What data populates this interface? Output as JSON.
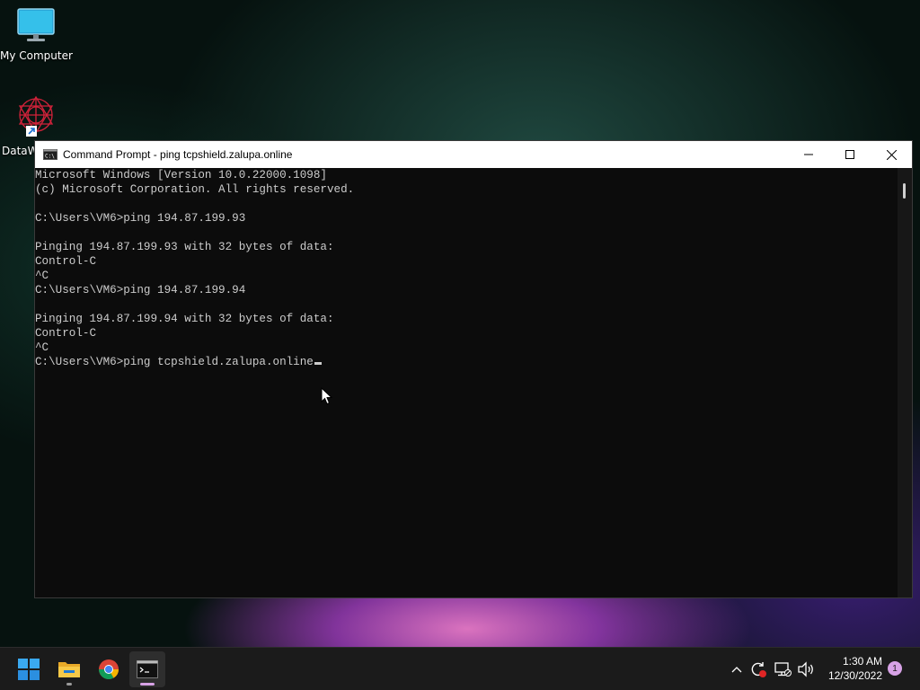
{
  "desktop": {
    "icons": [
      {
        "label": "My Computer",
        "icon": "monitor-icon"
      },
      {
        "label": "DataW",
        "icon": "datawatch-icon"
      }
    ]
  },
  "window": {
    "title": "Command Prompt - ping  tcpshield.zalupa.online",
    "app_icon": "cmd-icon",
    "controls": [
      "minimize-icon",
      "maximize-icon",
      "close-icon"
    ]
  },
  "console": {
    "lines": [
      "Microsoft Windows [Version 10.0.22000.1098]",
      "(c) Microsoft Corporation. All rights reserved.",
      "",
      "C:\\Users\\VM6>ping 194.87.199.93",
      "",
      "Pinging 194.87.199.93 with 32 bytes of data:",
      "Control-C",
      "^C",
      "C:\\Users\\VM6>ping 194.87.199.94",
      "",
      "Pinging 194.87.199.94 with 32 bytes of data:",
      "Control-C",
      "^C",
      "C:\\Users\\VM6>ping tcpshield.zalupa.online"
    ]
  },
  "taskbar": {
    "apps": [
      "start-icon",
      "file-explorer-icon",
      "chrome-icon",
      "terminal-icon"
    ],
    "active_app": "terminal-icon",
    "tray": [
      "chevron-up-icon",
      "update-icon",
      "network-icon",
      "volume-icon"
    ],
    "time": "1:30 AM",
    "date": "12/30/2022",
    "notification_count": "1"
  },
  "colors": {
    "console_bg": "#0c0c0c",
    "console_text": "#cccccc",
    "taskbar_bg": "#1b1b1b",
    "badge": "#d7a2e6"
  }
}
